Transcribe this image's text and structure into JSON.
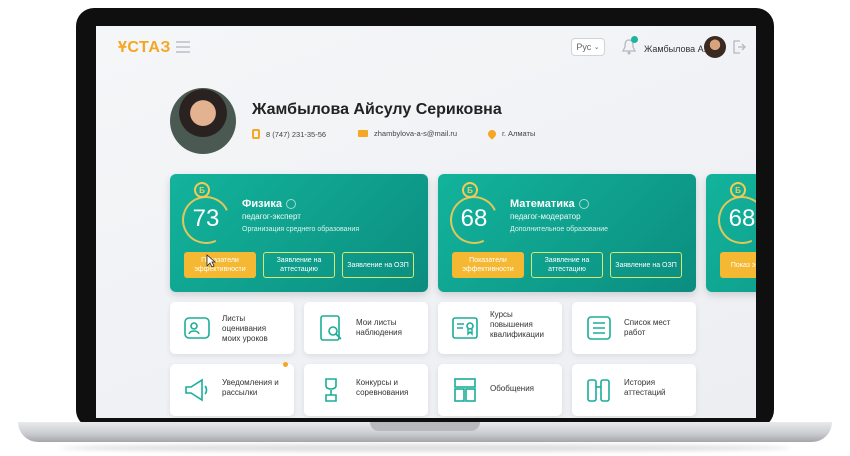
{
  "header": {
    "logo": "ҰСТАЗ",
    "language": "Рус",
    "user_name": "Жамбылова А."
  },
  "profile": {
    "full_name": "Жамбылова Айсулу Сериковна",
    "phone": "8 (747) 231-35-56",
    "email": "zhambylova-a-s@mail.ru",
    "city": "г. Алматы"
  },
  "cards": [
    {
      "score": "73",
      "badge": "Б",
      "subject": "Физика",
      "role": "педагог-эксперт",
      "org": "Организация среднего образования",
      "buttons": [
        "Показатели эффективности",
        "Заявление на аттестацию",
        "Заявление на ОЗП"
      ]
    },
    {
      "score": "68",
      "badge": "Б",
      "subject": "Математика",
      "role": "педагог-модератор",
      "org": "Дополнительное образование",
      "buttons": [
        "Показатели эффективности",
        "Заявление на аттестацию",
        "Заявление на ОЗП"
      ]
    },
    {
      "score": "68",
      "badge": "Б",
      "buttons": [
        "Показ эффекти"
      ]
    }
  ],
  "tiles": [
    {
      "label": "Листы оценивания моих уроков",
      "icon": "user-card-icon"
    },
    {
      "label": "Мои листы наблюдения",
      "icon": "search-document-icon"
    },
    {
      "label": "Курсы повышения квалификации",
      "icon": "certificate-icon"
    },
    {
      "label": "Список мест работ",
      "icon": "list-icon"
    },
    {
      "label": "Уведомления и рассылки",
      "icon": "megaphone-icon"
    },
    {
      "label": "Конкурсы и соревнования",
      "icon": "trophy-icon"
    },
    {
      "label": "Обобщения",
      "icon": "layers-icon"
    },
    {
      "label": "История аттестаций",
      "icon": "archive-icon"
    }
  ],
  "colors": {
    "accent": "#f5a623",
    "card": "#12b39c",
    "button_primary": "#f5b833"
  }
}
